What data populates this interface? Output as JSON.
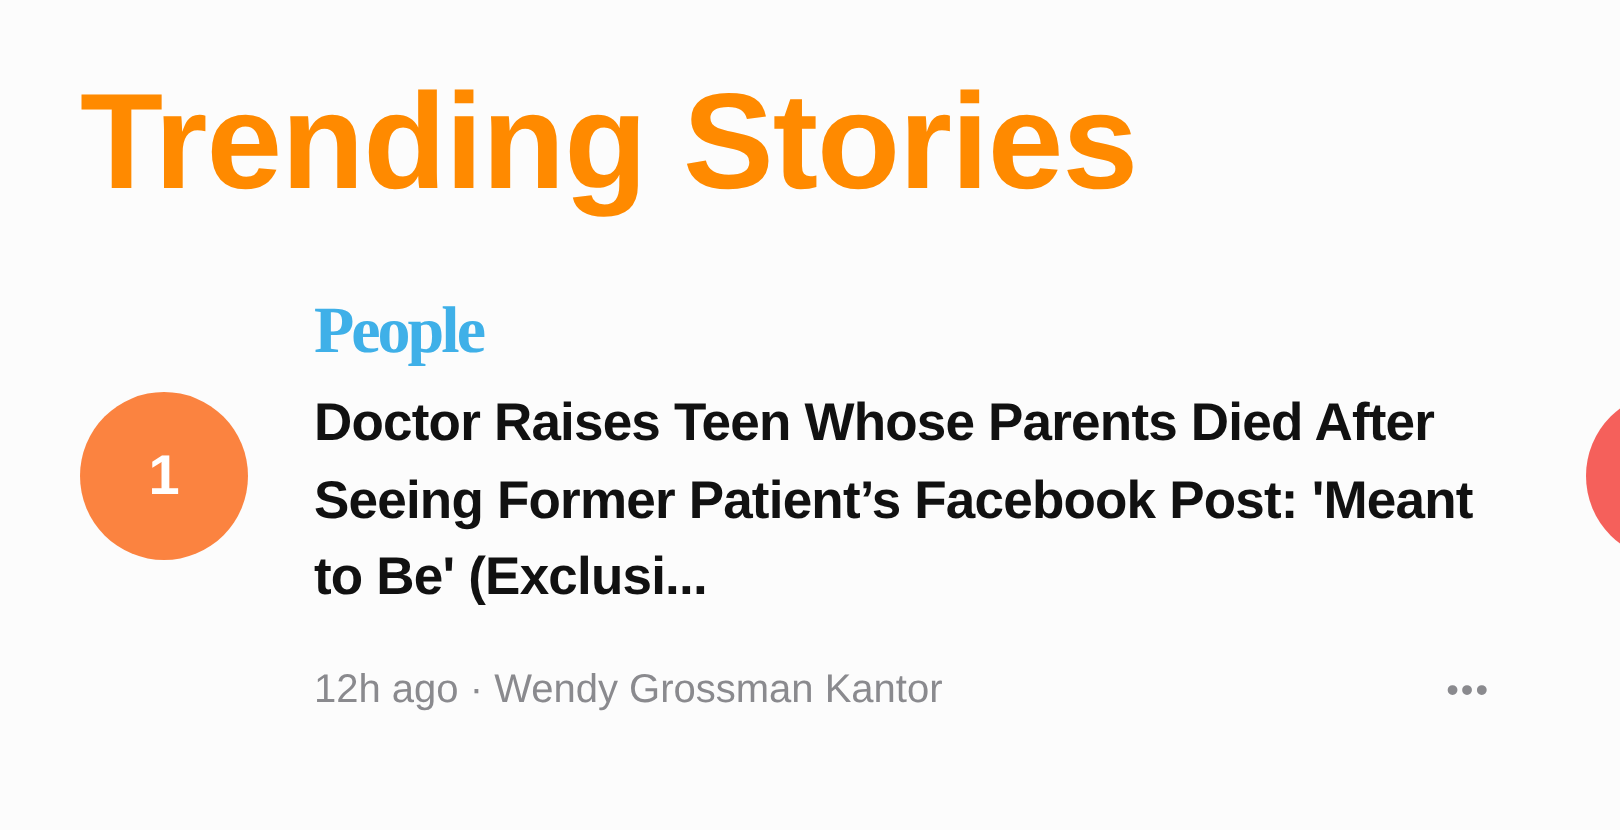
{
  "section_title": "Trending Stories",
  "cards": [
    {
      "rank": "1",
      "color": "#fb8340",
      "publisher": "People",
      "headline": "Doctor Raises Teen Whose Parents Died After Seeing Former Patient’s Facebook Post: 'Meant to Be' (Exclusi...",
      "age": "12h ago",
      "separator": "·",
      "author": "Wendy Grossman Kantor",
      "more": "•••"
    },
    {
      "color": "#f5605b"
    }
  ]
}
